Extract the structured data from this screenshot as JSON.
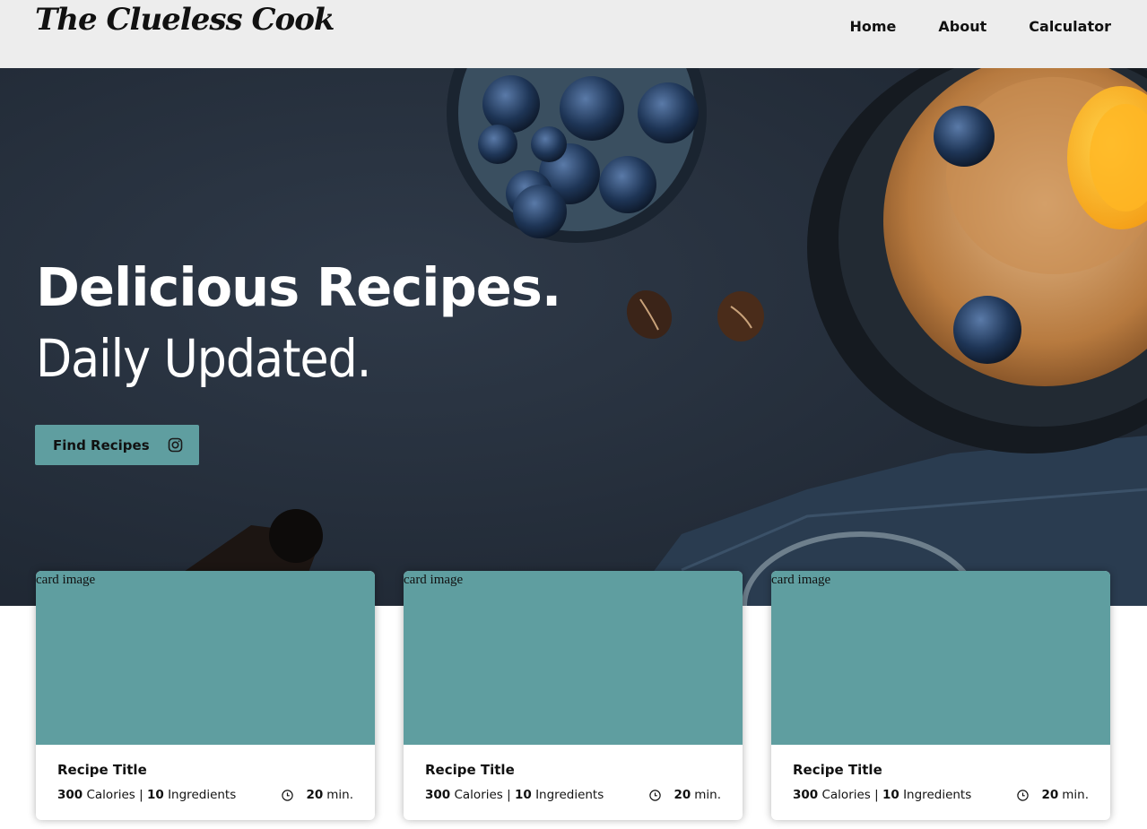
{
  "brand": {
    "logo_text": "The Clueless Cook"
  },
  "nav": {
    "links": [
      "Home",
      "About",
      "Calculator"
    ]
  },
  "hero": {
    "title": "Delicious Recipes.",
    "subtitle": "Daily Updated.",
    "button_label": "Find Recipes",
    "button_icon": "instagram-icon"
  },
  "colors": {
    "accent": "#5f9ea0",
    "navbar_bg": "#ededed",
    "hero_bg": "#26303d"
  },
  "cards": [
    {
      "image_alt": "card image",
      "title": "Recipe Title",
      "calories": "300",
      "calories_label": "Calories |",
      "ingredients": "10",
      "ingredients_label": "Ingredients",
      "time": "20",
      "time_unit": "min."
    },
    {
      "image_alt": "card image",
      "title": "Recipe Title",
      "calories": "300",
      "calories_label": "Calories |",
      "ingredients": "10",
      "ingredients_label": "Ingredients",
      "time": "20",
      "time_unit": "min."
    },
    {
      "image_alt": "card image",
      "title": "Recipe Title",
      "calories": "300",
      "calories_label": "Calories |",
      "ingredients": "10",
      "ingredients_label": "Ingredients",
      "time": "20",
      "time_unit": "min."
    }
  ]
}
